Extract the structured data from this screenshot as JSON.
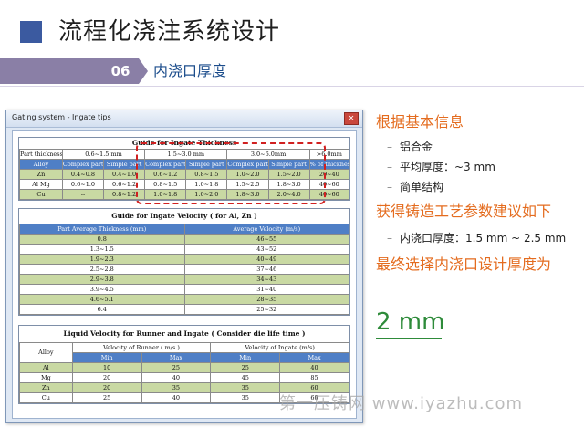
{
  "slide": {
    "title": "流程化浇注系统设计",
    "section_number": "06",
    "section_label": "内浇口厚度"
  },
  "dialog": {
    "title": "Gating system - Ingate tips",
    "close_glyph": "✕",
    "thickness": {
      "title": "Guide for Ingate Thickness",
      "part_thickness_label": "Part thickness",
      "ranges": [
        "0.6~1.5 mm",
        "1.5~3.0 mm",
        "3.0~6.0mm",
        ">6.0mm"
      ],
      "alloy_label": "Alloy",
      "subheaders": [
        "Complex part",
        "Simple part",
        "Complex part",
        "Simple part",
        "Complex part",
        "Simple part",
        "% of thickness"
      ],
      "rows": [
        {
          "alloy": "Zn",
          "values": [
            "0.4~0.8",
            "0.4~1.0",
            "0.6~1.2",
            "0.8~1.5",
            "1.0~2.0",
            "1.5~2.0",
            "20~40"
          ]
        },
        {
          "alloy": "Al Mg",
          "values": [
            "0.6~1.0",
            "0.6~1.2",
            "0.8~1.5",
            "1.0~1.8",
            "1.5~2.5",
            "1.8~3.0",
            "40~60"
          ]
        },
        {
          "alloy": "Cu",
          "values": [
            "--",
            "0.8~1.2",
            "1.0~1.8",
            "1.0~2.0",
            "1.8~3.0",
            "2.0~4.0",
            "40~60"
          ]
        }
      ]
    },
    "velocity": {
      "title": "Guide for Ingate Velocity ( for Al, Zn )",
      "headers": [
        "Part Average Thickness (mm)",
        "Average Velocity (m/s)"
      ],
      "rows": [
        [
          "0.8",
          "46~55"
        ],
        [
          "1.3~1.5",
          "43~52"
        ],
        [
          "1.9~2.3",
          "40~49"
        ],
        [
          "2.5~2.8",
          "37~46"
        ],
        [
          "2.9~3.8",
          "34~43"
        ],
        [
          "3.9~4.5",
          "31~40"
        ],
        [
          "4.6~5.1",
          "28~35"
        ],
        [
          "6.4",
          "25~32"
        ]
      ]
    },
    "liquid": {
      "title": "Liquid Velocity for Runner and Ingate ( Consider die life time )",
      "alloy_label": "Alloy",
      "runner_label": "Velocity of Runner ( m/s )",
      "ingate_label": "Velocity of Ingate (m/s)",
      "min_label": "Min",
      "max_label": "Max",
      "rows": [
        [
          "Al",
          "10",
          "25",
          "25",
          "40"
        ],
        [
          "Mg",
          "20",
          "40",
          "45",
          "85"
        ],
        [
          "Zn",
          "20",
          "35",
          "35",
          "60"
        ],
        [
          "Cu",
          "25",
          "40",
          "35",
          "60"
        ]
      ]
    }
  },
  "right": {
    "heading1": "根据基本信息",
    "bullets1": [
      "铝合金",
      "平均厚度：~3 mm",
      "简单结构"
    ],
    "heading2": "获得铸造工艺参数建议如下",
    "bullets2": [
      "内浇口厚度：1.5 mm ~ 2.5 mm"
    ],
    "heading3": "最终选择内浇口设计厚度为",
    "result": "2 mm",
    "dash": "–"
  },
  "watermark": "第一压铸网 www.iyazhu.com",
  "colors": {
    "accent_orange": "#e46c1f",
    "result_green": "#2e8b3a",
    "header_blue": "#4f7fc6",
    "row_green": "#c9d9a3",
    "highlight_red": "#d02020",
    "section_purple": "#8a7fa6"
  }
}
